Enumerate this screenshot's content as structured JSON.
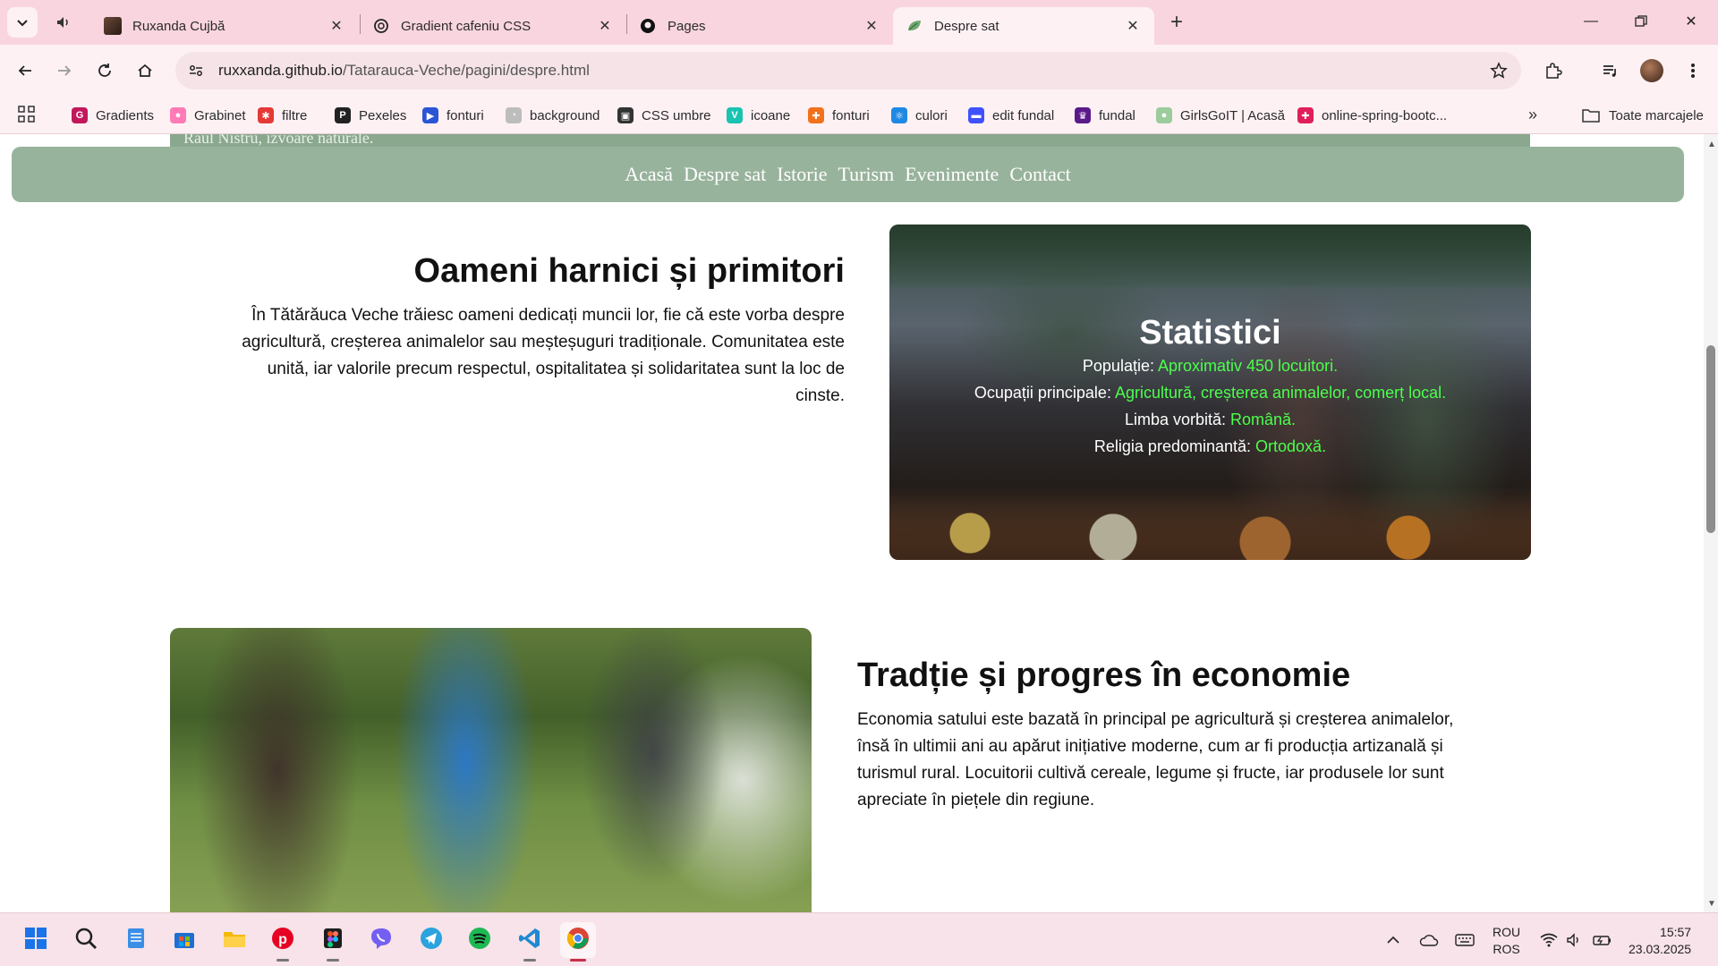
{
  "browser": {
    "tabs": [
      {
        "title": "Ruxanda Cujbă",
        "icon": "profile-photo-icon"
      },
      {
        "title": "Gradient cafeniu CSS",
        "icon": "openai-icon"
      },
      {
        "title": "Pages",
        "icon": "github-icon"
      },
      {
        "title": "Despre sat",
        "icon": "leaf-icon",
        "active": true
      }
    ],
    "url_host": "ruxxanda.github.io",
    "url_path": "/Tatarauca-Veche/pagini/despre.html",
    "bookmarks": [
      {
        "label": "Gradients",
        "color": "#c2185b",
        "letter": "G"
      },
      {
        "label": "Grabinet",
        "color": "#ff7ab6",
        "letter": "●"
      },
      {
        "label": "filtre",
        "color": "#e53935",
        "letter": "✱"
      },
      {
        "label": "Pexeles",
        "color": "#222222",
        "letter": "P"
      },
      {
        "label": "fonturi",
        "color": "#2a56d6",
        "letter": "▶"
      },
      {
        "label": "background",
        "color": "#bdbdbd",
        "letter": "◔"
      },
      {
        "label": "CSS umbre",
        "color": "#333333",
        "letter": "▣"
      },
      {
        "label": "icoane",
        "color": "#19c3b0",
        "letter": "V"
      },
      {
        "label": "fonturi",
        "color": "#f2711c",
        "letter": "✚"
      },
      {
        "label": "culori",
        "color": "#1e88e5",
        "letter": "⚛"
      },
      {
        "label": "edit fundal",
        "color": "#3f51ff",
        "letter": "▬"
      },
      {
        "label": "fundal",
        "color": "#5b1a8a",
        "letter": "♛"
      },
      {
        "label": "GirlsGoIT | Acasă",
        "color": "#9ccc9c",
        "letter": "●"
      },
      {
        "label": "online-spring-bootc...",
        "color": "#e01e5a",
        "letter": "✚"
      }
    ],
    "all_bookmarks": "Toate marcajele"
  },
  "page": {
    "header_strip_text": "Râul Nistru, izvoare naturale.",
    "nav": [
      "Acasă",
      "Despre sat",
      "Istorie",
      "Turism",
      "Evenimente",
      "Contact"
    ],
    "section1": {
      "title": "Oameni harnici și primitori",
      "text": "În Tătărăuca Veche trăiesc oameni dedicați muncii lor, fie că este vorba despre agricultură, creșterea animalelor sau meșteșuguri tradiționale. Comunitatea este unită, iar valorile precum respectul, ospitalitatea și solidaritatea sunt la loc de cinste."
    },
    "stats": {
      "title": "Statistici",
      "items": [
        {
          "label": "Populație:",
          "value": "Aproximativ 450 locuitori."
        },
        {
          "label": "Ocupații principale:",
          "value": "Agricultură, creșterea animalelor, comerț local."
        },
        {
          "label": "Limba vorbită:",
          "value": "Română."
        },
        {
          "label": "Religia predominantă:",
          "value": "Ortodoxă."
        }
      ],
      "value_color": "#4cff4c"
    },
    "section2": {
      "title": "Tradție și progres în economie",
      "text": "Economia satului este bazată în principal pe agricultură și creșterea animalelor, însă în ultimii ani au apărut inițiative moderne, cum ar fi producția artizanală și turismul rural. Locuitorii cultivă cereale, legume și fructe, iar produsele lor sunt apreciate în piețele din regiune."
    },
    "nav_color": "#98b39c"
  },
  "taskbar": {
    "apps": [
      "windows-start-icon",
      "search-icon",
      "notepad-icon",
      "store-icon",
      "file-explorer-icon",
      "pinterest-icon",
      "figma-icon",
      "viber-icon",
      "telegram-icon",
      "spotify-icon",
      "vscode-icon",
      "chrome-icon"
    ],
    "lang_line1": "ROU",
    "lang_line2": "ROS",
    "time": "15:57",
    "date": "23.03.2025"
  }
}
